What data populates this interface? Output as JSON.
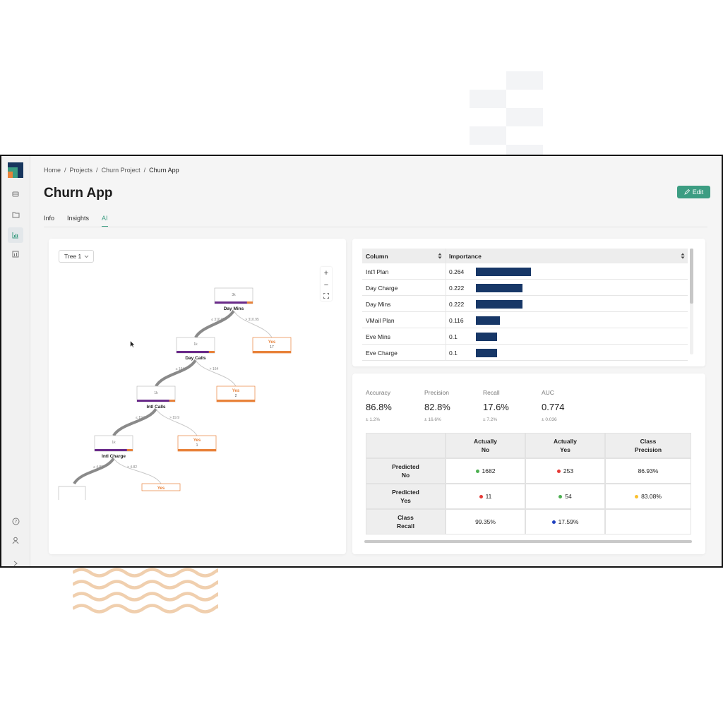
{
  "breadcrumb": [
    "Home",
    "Projects",
    "Churn Project",
    "Churn App"
  ],
  "page_title": "Churn App",
  "edit_label": "Edit",
  "tabs": [
    {
      "label": "Info",
      "active": false
    },
    {
      "label": "Insights",
      "active": false
    },
    {
      "label": "AI",
      "active": true
    }
  ],
  "tree": {
    "selector": "Tree 1",
    "zoom_in": "+",
    "zoom_out": "−",
    "nodes": [
      {
        "count": "3k",
        "label": "Day Mins"
      },
      {
        "count": "1k",
        "label": "Day Calls"
      },
      {
        "count": "1k",
        "label": "Intl Calls"
      },
      {
        "count": "1k",
        "label": "Intl Charge"
      }
    ],
    "leaves": [
      {
        "label": "Yes",
        "count": "17"
      },
      {
        "label": "Yes",
        "count": "2"
      },
      {
        "label": "Yes",
        "count": "1"
      },
      {
        "label": "Yes",
        "count": ""
      }
    ],
    "edges": [
      {
        "left": "≤ 310.95",
        "right": "> 310.95"
      },
      {
        "left": "≤ 164",
        "right": "> 164"
      },
      {
        "left": "≤ 19.9",
        "right": "> 19.9"
      },
      {
        "left": "≤ 4.82",
        "right": "> 4.82"
      }
    ]
  },
  "feature_importance": {
    "headers": {
      "column": "Column",
      "importance": "Importance"
    },
    "rows": [
      {
        "column": "Int'l Plan",
        "importance": "0.264",
        "value": 0.264
      },
      {
        "column": "Day Charge",
        "importance": "0.222",
        "value": 0.222
      },
      {
        "column": "Day Mins",
        "importance": "0.222",
        "value": 0.222
      },
      {
        "column": "VMail Plan",
        "importance": "0.116",
        "value": 0.116
      },
      {
        "column": "Eve Mins",
        "importance": "0.1",
        "value": 0.1
      },
      {
        "column": "Eve Charge",
        "importance": "0.1",
        "value": 0.1
      }
    ],
    "bar_color": "#173767"
  },
  "metrics": [
    {
      "label": "Accuracy",
      "value": "86.8%",
      "ci": "± 1.2%"
    },
    {
      "label": "Precision",
      "value": "82.8%",
      "ci": "± 16.6%"
    },
    {
      "label": "Recall",
      "value": "17.6%",
      "ci": "± 7.2%"
    },
    {
      "label": "AUC",
      "value": "0.774",
      "ci": "± 0.036"
    }
  ],
  "confusion_matrix": {
    "col_headers": [
      "Actually\nNo",
      "Actually\nYes",
      "Class\nPrecision"
    ],
    "row_headers": [
      "Predicted\nNo",
      "Predicted\nYes",
      "Class\nRecall"
    ],
    "cells": [
      [
        {
          "text": "1682",
          "dot": "#4caf50"
        },
        {
          "text": "253",
          "dot": "#e53935"
        },
        {
          "text": "86.93%",
          "dot": ""
        }
      ],
      [
        {
          "text": "11",
          "dot": "#e53935"
        },
        {
          "text": "54",
          "dot": "#4caf50"
        },
        {
          "text": "83.08%",
          "dot": "#fbc02d"
        }
      ],
      [
        {
          "text": "99.35%",
          "dot": ""
        },
        {
          "text": "17.59%",
          "dot": "#1e3fbf"
        },
        {
          "text": "",
          "dot": ""
        }
      ]
    ]
  },
  "colors": {
    "accent": "#3c9d82",
    "leaf": "#e8823a",
    "node_bar": "#6a2a8a"
  }
}
